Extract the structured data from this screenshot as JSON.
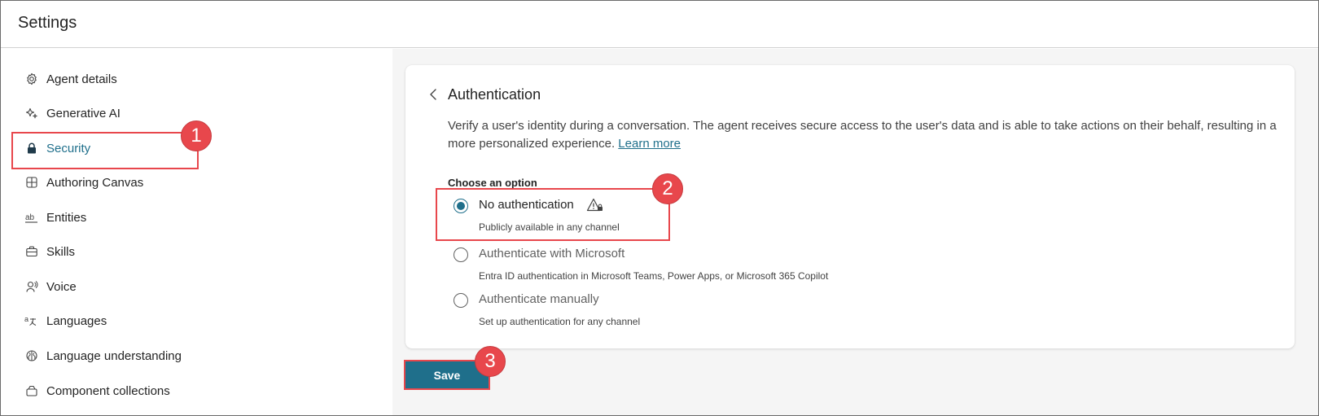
{
  "header": {
    "title": "Settings"
  },
  "sidebar": {
    "items": [
      {
        "label": "Agent details",
        "icon": "gear-icon"
      },
      {
        "label": "Generative AI",
        "icon": "sparkle-icon"
      },
      {
        "label": "Security",
        "icon": "lock-icon",
        "active": true
      },
      {
        "label": "Authoring Canvas",
        "icon": "grid-icon"
      },
      {
        "label": "Entities",
        "icon": "text-ab-icon"
      },
      {
        "label": "Skills",
        "icon": "briefcase-icon"
      },
      {
        "label": "Voice",
        "icon": "voice-person-icon"
      },
      {
        "label": "Languages",
        "icon": "translate-icon"
      },
      {
        "label": "Language understanding",
        "icon": "brain-icon"
      },
      {
        "label": "Component collections",
        "icon": "collection-icon"
      }
    ]
  },
  "card": {
    "title": "Authentication",
    "description": "Verify a user's identity during a conversation. The agent receives secure access to the user's data and is able to take actions on their behalf, resulting in a more personalized experience.",
    "learn_more": "Learn more",
    "choose_label": "Choose an option",
    "options": [
      {
        "label": "No authentication",
        "sub": "Publicly available in any channel",
        "selected": true,
        "has_warning": true
      },
      {
        "label": "Authenticate with Microsoft",
        "sub": "Entra ID authentication in Microsoft Teams, Power Apps, or Microsoft 365 Copilot",
        "selected": false
      },
      {
        "label": "Authenticate manually",
        "sub": "Set up authentication for any channel",
        "selected": false
      }
    ]
  },
  "save_label": "Save",
  "annotations": {
    "step1": "1",
    "step2": "2",
    "step3": "3"
  },
  "colors": {
    "accent": "#1f6f8b",
    "annotation": "#e8474c",
    "panel_bg": "#f5f5f5"
  }
}
